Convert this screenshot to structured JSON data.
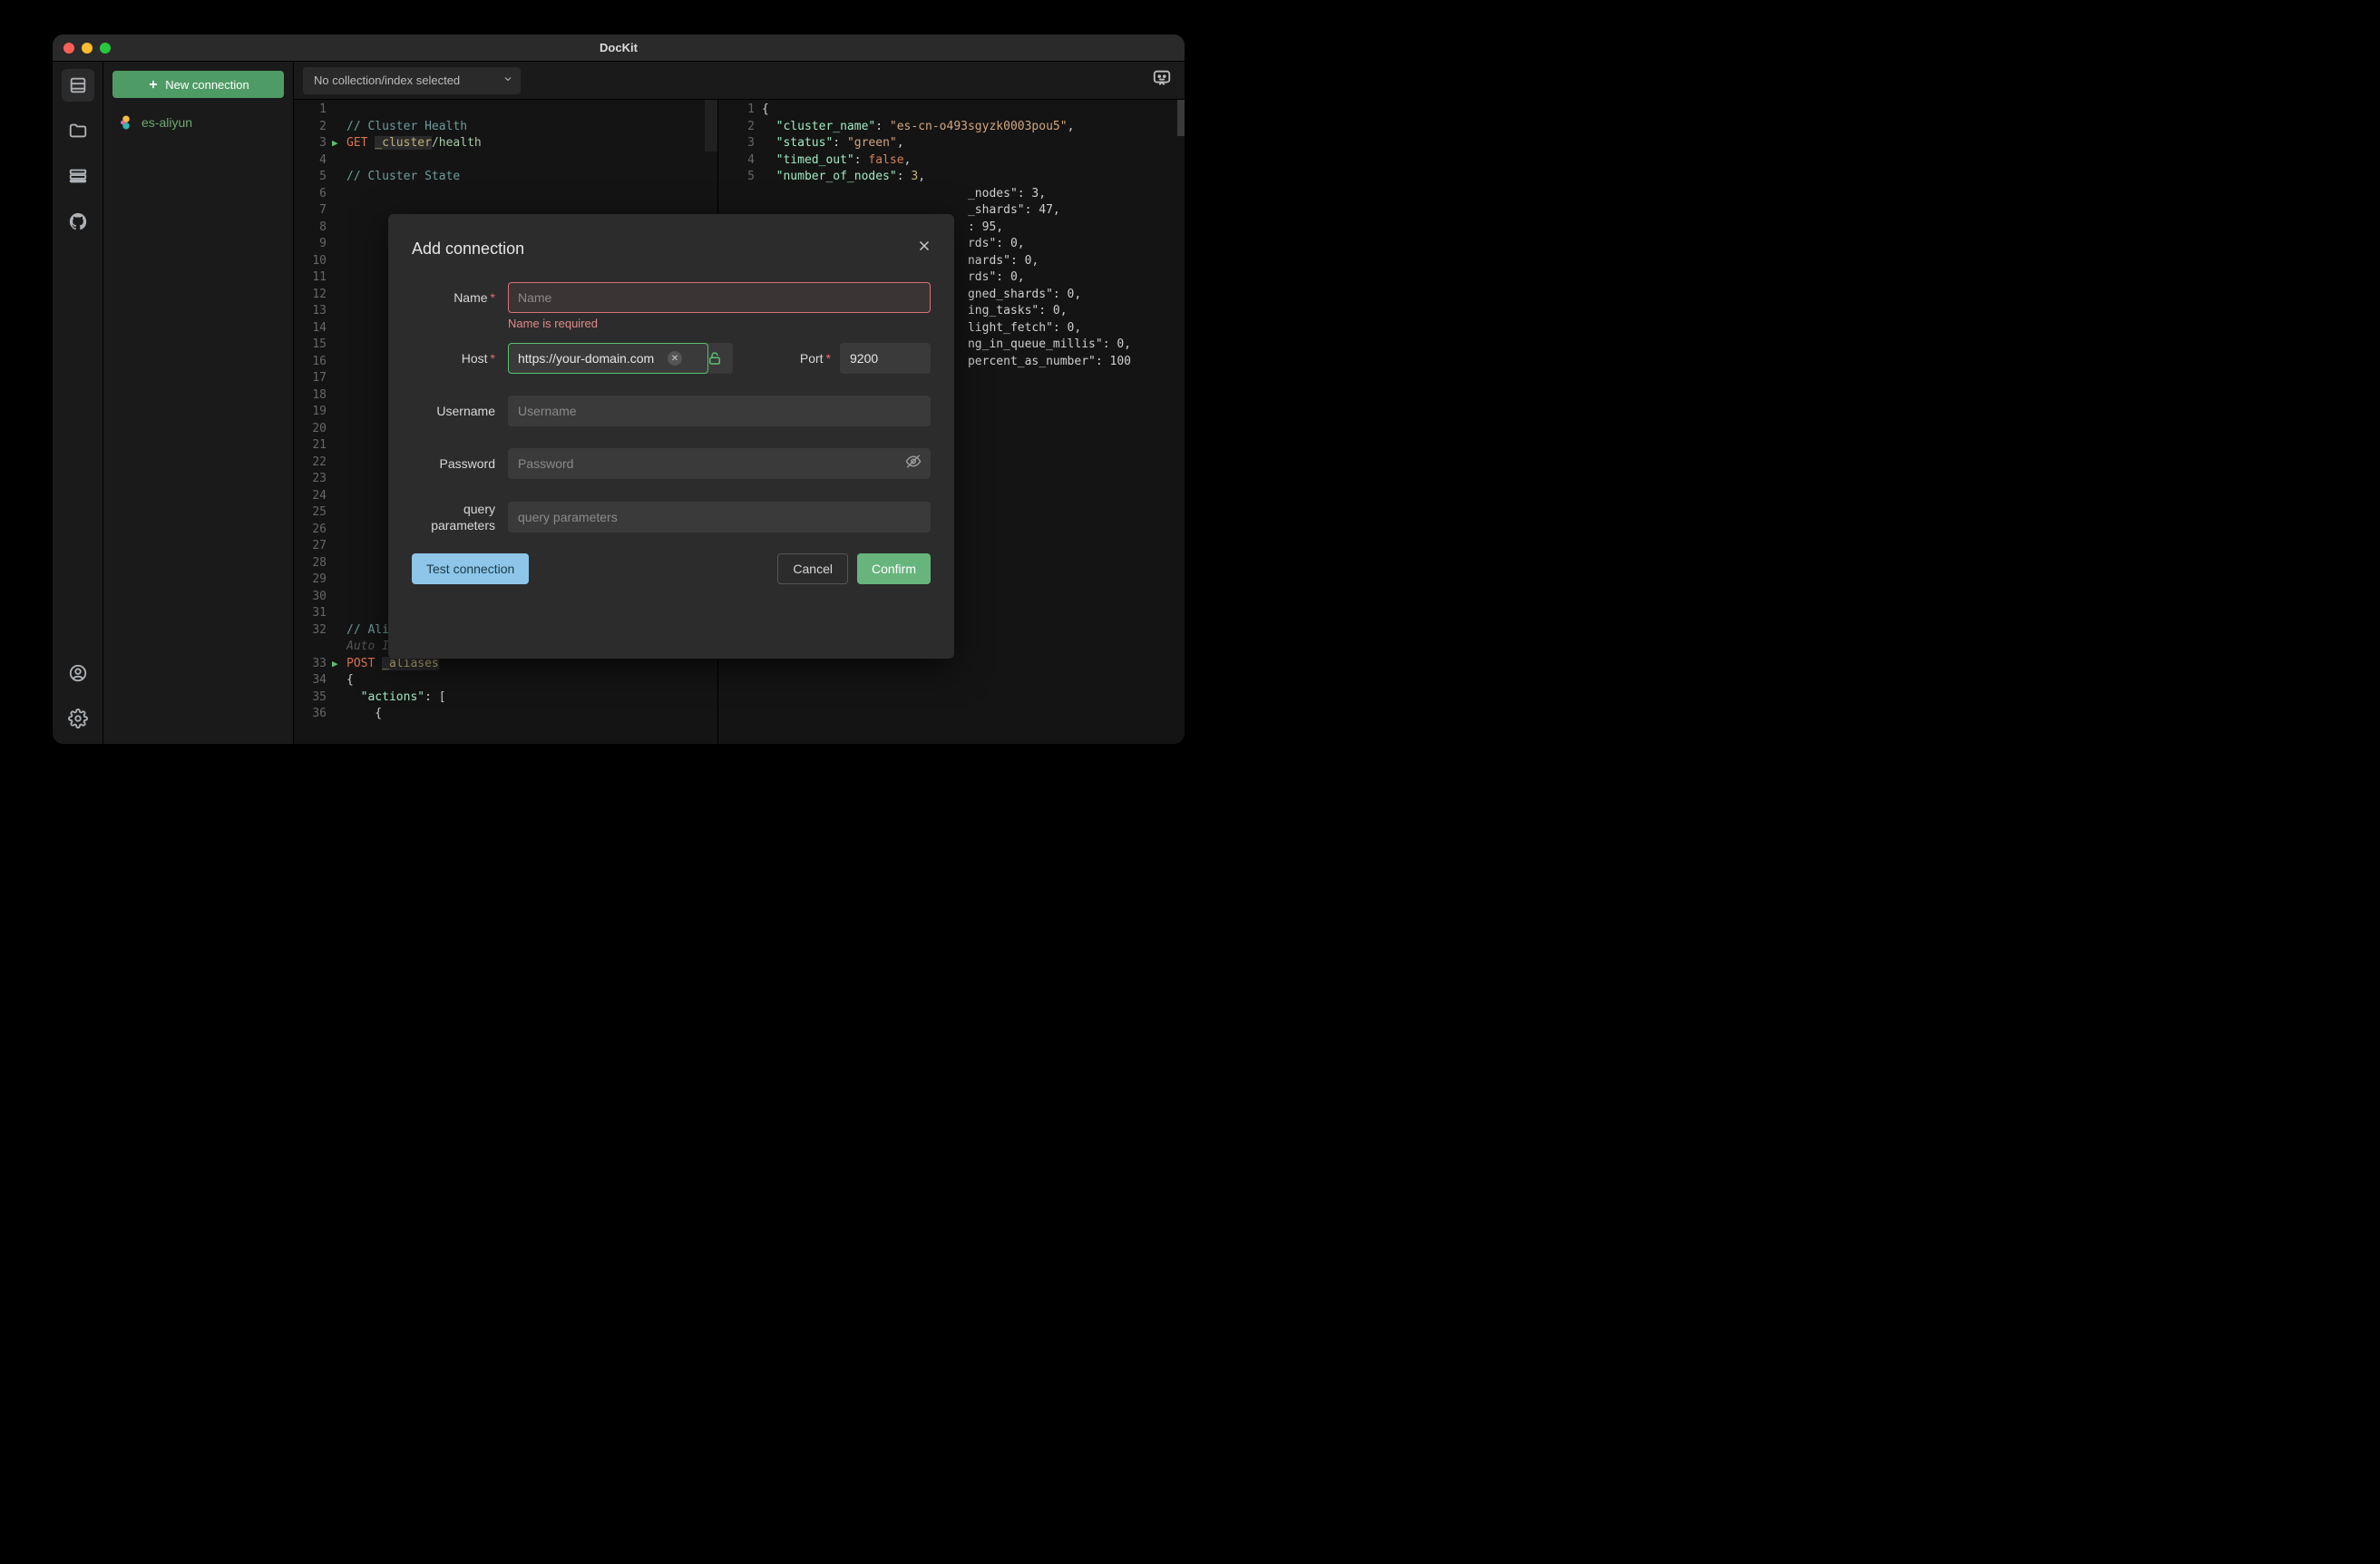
{
  "window": {
    "title": "DocKit"
  },
  "sidebar": {
    "new_connection_label": "New connection",
    "connections": [
      {
        "name": "es-aliyun"
      }
    ]
  },
  "toolbar": {
    "dropdown_text": "No collection/index selected"
  },
  "editor_left": {
    "lines": [
      {
        "n": 1,
        "text": ""
      },
      {
        "n": 2,
        "comment": "// Cluster Health"
      },
      {
        "n": 3,
        "run": true,
        "kw": "GET",
        "path1": "_cluster",
        "path2": "/health"
      },
      {
        "n": 4,
        "text": ""
      },
      {
        "n": 5,
        "comment": "// Cluster State"
      },
      {
        "n": 6,
        "text": ""
      },
      {
        "n": 7,
        "text": ""
      },
      {
        "n": 8,
        "text": ""
      },
      {
        "n": 9,
        "text": ""
      },
      {
        "n": 10,
        "text": ""
      },
      {
        "n": 11,
        "text": ""
      },
      {
        "n": 12,
        "text": ""
      },
      {
        "n": 13,
        "text": ""
      },
      {
        "n": 14,
        "text": ""
      },
      {
        "n": 15,
        "text": ""
      },
      {
        "n": 16,
        "text": ""
      },
      {
        "n": 17,
        "text": ""
      },
      {
        "n": 18,
        "text": ""
      },
      {
        "n": 19,
        "text": ""
      },
      {
        "n": 20,
        "text": ""
      },
      {
        "n": 21,
        "text": ""
      },
      {
        "n": 22,
        "text": ""
      },
      {
        "n": 23,
        "text": ""
      },
      {
        "n": 24,
        "text": ""
      },
      {
        "n": 25,
        "text": ""
      },
      {
        "n": 26,
        "text": ""
      },
      {
        "n": 27,
        "text": ""
      },
      {
        "n": 28,
        "text": ""
      },
      {
        "n": 29,
        "text": ""
      },
      {
        "n": 30,
        "text": ""
      },
      {
        "n": 31,
        "text": ""
      },
      {
        "n": 32,
        "comment": "// Aliases"
      },
      {
        "n": "",
        "ghost": "Auto Indent"
      },
      {
        "n": 33,
        "run": true,
        "kw": "POST",
        "path1": "_aliases"
      },
      {
        "n": 34,
        "brace": "{"
      },
      {
        "n": 35,
        "objline_key": "\"actions\"",
        "objline_rest": ": ["
      },
      {
        "n": 36,
        "brace": "    {"
      }
    ]
  },
  "editor_right": {
    "lines": [
      {
        "n": 1,
        "raw": "{"
      },
      {
        "n": 2,
        "key": "\"cluster_name\"",
        "sep": ": ",
        "str": "\"es-cn-o493sgyzk0003pou5\"",
        "tail": ","
      },
      {
        "n": 3,
        "key": "\"status\"",
        "sep": ": ",
        "str": "\"green\"",
        "tail": ","
      },
      {
        "n": 4,
        "key": "\"timed_out\"",
        "sep": ": ",
        "bool": "false",
        "tail": ","
      },
      {
        "n": 5,
        "key": "\"number_of_nodes\"",
        "sep": ": ",
        "num": "3",
        "tail": ","
      },
      {
        "n": "",
        "tail_partial": "_nodes\": 3,"
      },
      {
        "n": "",
        "tail_partial": "_shards\": 47,"
      },
      {
        "n": "",
        "tail_partial": ": 95,"
      },
      {
        "n": "",
        "tail_partial": "rds\": 0,"
      },
      {
        "n": "",
        "tail_partial": "nards\": 0,"
      },
      {
        "n": "",
        "tail_partial": "rds\": 0,"
      },
      {
        "n": "",
        "tail_partial": "gned_shards\": 0,"
      },
      {
        "n": "",
        "tail_partial": "ing_tasks\": 0,"
      },
      {
        "n": "",
        "tail_partial": "light_fetch\": 0,"
      },
      {
        "n": "",
        "tail_partial": "ng_in_queue_millis\": 0,"
      },
      {
        "n": "",
        "tail_partial": "percent_as_number\": 100"
      },
      {
        "n": "",
        "raw": ""
      }
    ]
  },
  "modal": {
    "title": "Add connection",
    "fields": {
      "name_label": "Name",
      "name_placeholder": "Name",
      "name_error": "Name is required",
      "host_label": "Host",
      "host_value": "https://your-domain.com",
      "port_label": "Port",
      "port_value": "9200",
      "username_label": "Username",
      "username_placeholder": "Username",
      "password_label": "Password",
      "password_placeholder": "Password",
      "query_label_line1": "query",
      "query_label_line2": "parameters",
      "query_placeholder": "query parameters"
    },
    "buttons": {
      "test": "Test connection",
      "cancel": "Cancel",
      "confirm": "Confirm"
    }
  }
}
